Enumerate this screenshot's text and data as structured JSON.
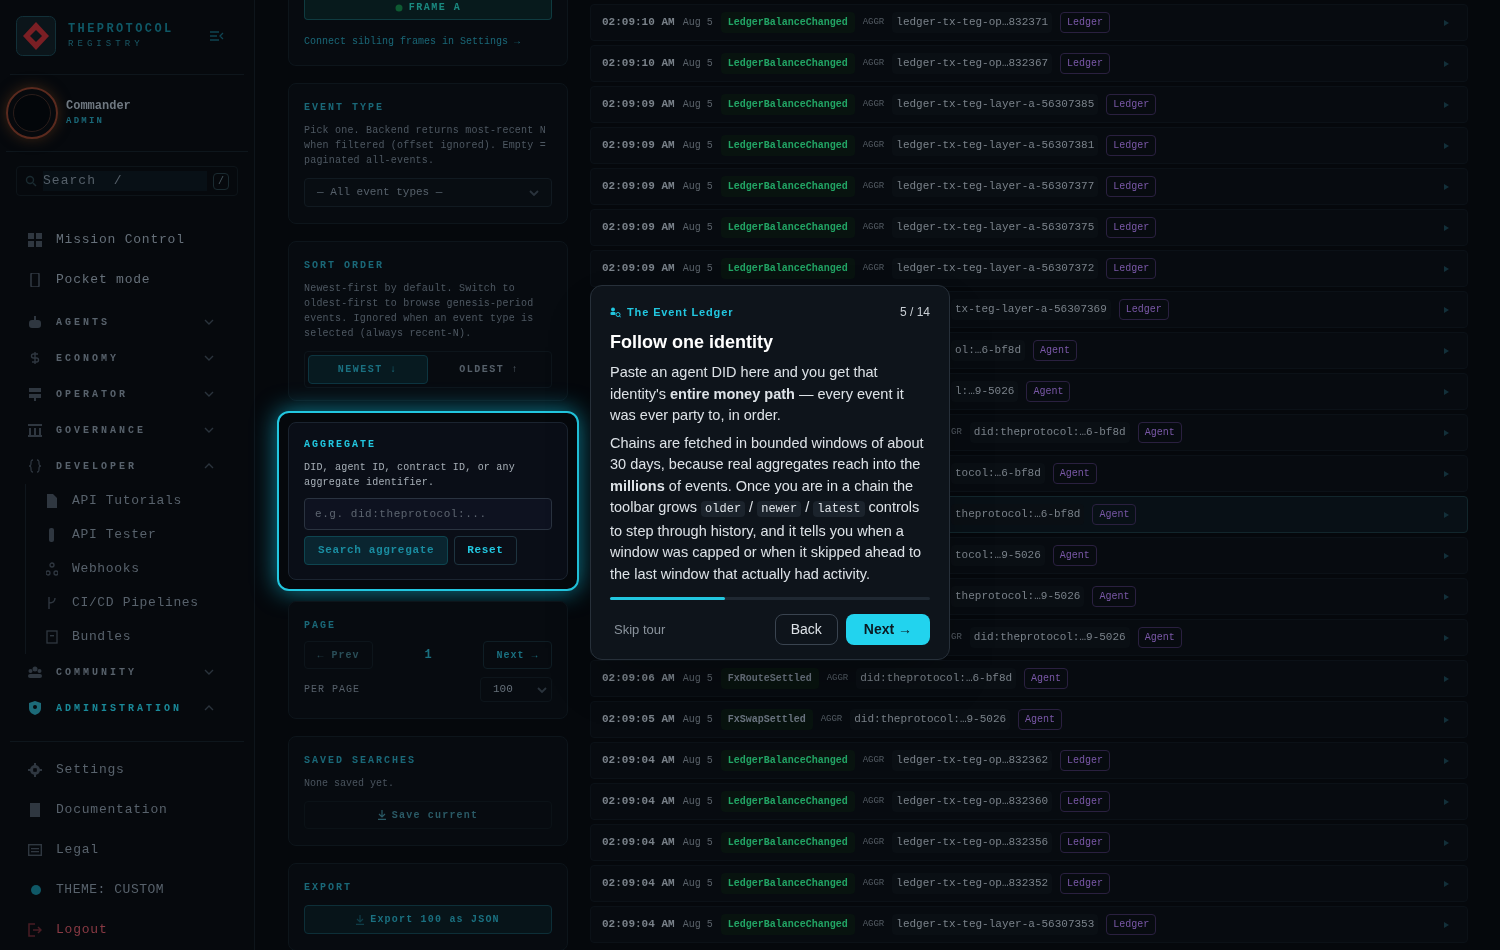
{
  "sidebar": {
    "brand": {
      "name": "THEPROTOCOL",
      "sub": "REGISTRY"
    },
    "user": {
      "name": "Commander",
      "role": "ADMIN"
    },
    "search": {
      "placeholder": "Search  /",
      "shortcut": "/"
    },
    "nav": [
      {
        "kind": "link",
        "label": "Mission Control"
      },
      {
        "kind": "link",
        "label": "Pocket mode"
      },
      {
        "kind": "group",
        "label": "AGENTS",
        "expanded": false,
        "selected": false
      },
      {
        "kind": "group",
        "label": "ECONOMY",
        "expanded": false,
        "selected": false
      },
      {
        "kind": "group",
        "label": "OPERATOR",
        "expanded": false,
        "selected": false
      },
      {
        "kind": "group",
        "label": "GOVERNANCE",
        "expanded": false,
        "selected": false
      },
      {
        "kind": "group",
        "label": "DEVELOPER",
        "expanded": true,
        "selected": false,
        "children": [
          {
            "label": "API Tutorials"
          },
          {
            "label": "API Tester"
          },
          {
            "label": "Webhooks"
          },
          {
            "label": "CI/CD Pipelines"
          },
          {
            "label": "Bundles"
          }
        ]
      },
      {
        "kind": "group",
        "label": "COMMUNITY",
        "expanded": false,
        "selected": false
      },
      {
        "kind": "group",
        "label": "ADMINISTRATION",
        "expanded": true,
        "selected": true
      }
    ],
    "footer": [
      {
        "label": "Settings"
      },
      {
        "label": "Documentation"
      },
      {
        "label": "Legal"
      }
    ],
    "theme": "THEME: CUSTOM",
    "logout": "Logout"
  },
  "filters": {
    "frame": {
      "button": "FRAME A",
      "link": "Connect sibling frames in Settings →"
    },
    "event_type": {
      "title": "EVENT TYPE",
      "description": "Pick one. Backend returns most-recent N when filtered (offset ignored). Empty = paginated all-events.",
      "select": "— All event types —"
    },
    "sort_order": {
      "title": "SORT ORDER",
      "description": "Newest-first by default. Switch to oldest-first to browse genesis-period events. Ignored when an event type is selected (always recent-N).",
      "options": [
        {
          "label": "NEWEST ↓",
          "selected": true
        },
        {
          "label": "OLDEST ↑",
          "selected": false
        }
      ]
    },
    "aggregate": {
      "title": "AGGREGATE",
      "description": "DID, agent ID, contract ID, or any aggregate identifier.",
      "placeholder": "e.g. did:theprotocol:...",
      "search_button": "Search aggregate",
      "reset_button": "Reset"
    },
    "page": {
      "title": "PAGE",
      "prev": "← Prev",
      "prev_disabled": true,
      "current": "1",
      "next": "Next →",
      "per_page_label": "PER PAGE",
      "per_page": "100"
    },
    "saved_searches": {
      "title": "SAVED SEARCHES",
      "empty": "None saved yet.",
      "button": "Save current"
    },
    "export": {
      "title": "EXPORT",
      "button": "Export 100 as JSON"
    }
  },
  "events": [
    {
      "time": "02:09:10 AM",
      "date": "Aug 5",
      "event": "LedgerBalanceChanged",
      "color": "#22a565",
      "aggr_label": "AGGR",
      "aggregate": "ledger-tx-teg-op…832371",
      "tag": "Ledger",
      "selected": false
    },
    {
      "time": "02:09:10 AM",
      "date": "Aug 5",
      "event": "LedgerBalanceChanged",
      "color": "#22a565",
      "aggr_label": "AGGR",
      "aggregate": "ledger-tx-teg-op…832367",
      "tag": "Ledger",
      "selected": false
    },
    {
      "time": "02:09:09 AM",
      "date": "Aug 5",
      "event": "LedgerBalanceChanged",
      "color": "#22a565",
      "aggr_label": "AGGR",
      "aggregate": "ledger-tx-teg-layer-a-56307385",
      "tag": "Ledger",
      "selected": false
    },
    {
      "time": "02:09:09 AM",
      "date": "Aug 5",
      "event": "LedgerBalanceChanged",
      "color": "#22a565",
      "aggr_label": "AGGR",
      "aggregate": "ledger-tx-teg-layer-a-56307381",
      "tag": "Ledger",
      "selected": false
    },
    {
      "time": "02:09:09 AM",
      "date": "Aug 5",
      "event": "LedgerBalanceChanged",
      "color": "#22a565",
      "aggr_label": "AGGR",
      "aggregate": "ledger-tx-teg-layer-a-56307377",
      "tag": "Ledger",
      "selected": false
    },
    {
      "time": "02:09:09 AM",
      "date": "Aug 5",
      "event": "LedgerBalanceChanged",
      "color": "#22a565",
      "aggr_label": "AGGR",
      "aggregate": "ledger-tx-teg-layer-a-56307375",
      "tag": "Ledger",
      "selected": false
    },
    {
      "time": "02:09:09 AM",
      "date": "Aug 5",
      "event": "LedgerBalanceChanged",
      "color": "#22a565",
      "aggr_label": "AGGR",
      "aggregate": "ledger-tx-teg-layer-a-56307372",
      "tag": "Ledger",
      "selected": false
    },
    {
      "aggregate": "tx-teg-layer-a-56307369",
      "tag": "Ledger",
      "selected": false
    },
    {
      "aggregate": "ol:…6-bf8d",
      "tag": "Agent",
      "selected": false
    },
    {
      "aggregate": "l:…9-5026",
      "tag": "Agent",
      "selected": false
    },
    {
      "aggr_label": "GR",
      "aggregate": "did:theprotocol:…6-bf8d",
      "tag": "Agent",
      "selected": false
    },
    {
      "aggregate": "tocol:…6-bf8d",
      "tag": "Agent",
      "selected": false
    },
    {
      "aggregate": "theprotocol:…6-bf8d",
      "tag": "Agent",
      "selected": true
    },
    {
      "aggregate": "tocol:…9-5026",
      "tag": "Agent",
      "selected": false
    },
    {
      "aggregate": "theprotocol:…9-5026",
      "tag": "Agent",
      "selected": false
    },
    {
      "aggr_label": "GR",
      "aggregate": "did:theprotocol:…9-5026",
      "tag": "Agent",
      "selected": false
    },
    {
      "time": "02:09:06 AM",
      "date": "Aug 5",
      "event": "FxRouteSettled",
      "color": "#6b7480",
      "aggr_label": "AGGR",
      "aggregate": "did:theprotocol:…6-bf8d",
      "tag": "Agent",
      "selected": false
    },
    {
      "time": "02:09:05 AM",
      "date": "Aug 5",
      "event": "FxSwapSettled",
      "color": "#6b7480",
      "aggr_label": "AGGR",
      "aggregate": "did:theprotocol:…9-5026",
      "tag": "Agent",
      "selected": false
    },
    {
      "time": "02:09:04 AM",
      "date": "Aug 5",
      "event": "LedgerBalanceChanged",
      "color": "#22a565",
      "aggr_label": "AGGR",
      "aggregate": "ledger-tx-teg-op…832362",
      "tag": "Ledger",
      "selected": false
    },
    {
      "time": "02:09:04 AM",
      "date": "Aug 5",
      "event": "LedgerBalanceChanged",
      "color": "#22a565",
      "aggr_label": "AGGR",
      "aggregate": "ledger-tx-teg-op…832360",
      "tag": "Ledger",
      "selected": false
    },
    {
      "time": "02:09:04 AM",
      "date": "Aug 5",
      "event": "LedgerBalanceChanged",
      "color": "#22a565",
      "aggr_label": "AGGR",
      "aggregate": "ledger-tx-teg-op…832356",
      "tag": "Ledger",
      "selected": false
    },
    {
      "time": "02:09:04 AM",
      "date": "Aug 5",
      "event": "LedgerBalanceChanged",
      "color": "#22a565",
      "aggr_label": "AGGR",
      "aggregate": "ledger-tx-teg-op…832352",
      "tag": "Ledger",
      "selected": false
    },
    {
      "time": "02:09:04 AM",
      "date": "Aug 5",
      "event": "LedgerBalanceChanged",
      "color": "#22a565",
      "aggr_label": "AGGR",
      "aggregate": "ledger-tx-teg-layer-a-56307353",
      "tag": "Ledger",
      "selected": false
    }
  ],
  "tour": {
    "kicker": "The Event Ledger",
    "step": "5 / 14",
    "title": "Follow one identity",
    "paragraphs": [
      [
        {
          "kind": "text",
          "text": "Paste an agent DID here and you get that identity's **entire money path** — every event it was ever party to, in order."
        }
      ],
      [
        {
          "kind": "text",
          "text": "Chains are fetched in bounded windows of about 30 days, because real aggregates reach into the **millions** of events. Once you are in a chain the toolbar grows "
        },
        {
          "kind": "code",
          "text": "older"
        },
        {
          "kind": "text",
          "text": " / "
        },
        {
          "kind": "code",
          "text": "newer"
        },
        {
          "kind": "text",
          "text": " / "
        },
        {
          "kind": "code",
          "text": "latest"
        },
        {
          "kind": "text",
          "text": " controls to step through history, and it tells you when a window was capped or when it skipped ahead to the last window that actually had activity."
        }
      ]
    ],
    "level": 0.36,
    "skip": "Skip tour",
    "back": "Back",
    "next": "Next →"
  }
}
